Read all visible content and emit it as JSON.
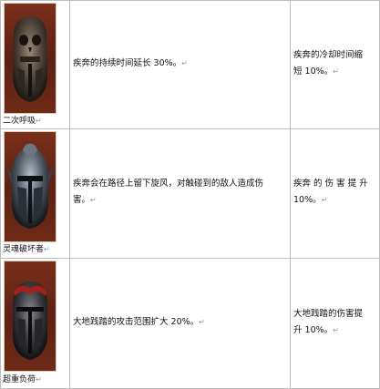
{
  "rows": [
    {
      "caption": "二次呼吸",
      "effect": "疾奔的持续时间延长 30%",
      "effect_lines": [
        "疾奔的持续时间延长 30%。"
      ],
      "bonus_lines": [
        "疾奔的冷却时间缩",
        "短 10%。"
      ]
    },
    {
      "caption": "灵魂破坏者",
      "effect_lines": [
        "疾奔会在路径上留下旋风，对触碰到的敌人造成伤",
        "害。"
      ],
      "bonus_lines": [
        "疾奔 的 伤 害 提 升",
        "10%。"
      ]
    },
    {
      "caption": "超重负荷",
      "effect_lines": [
        "大地践踏的攻击范围扩大 20%。"
      ],
      "bonus_lines": [
        "大地践踏的伤害提",
        "升 10%。"
      ]
    }
  ],
  "paragraph_mark": "↵",
  "icons": [
    "helmet-skull-icon",
    "helmet-winged-icon",
    "helmet-horned-icon"
  ]
}
